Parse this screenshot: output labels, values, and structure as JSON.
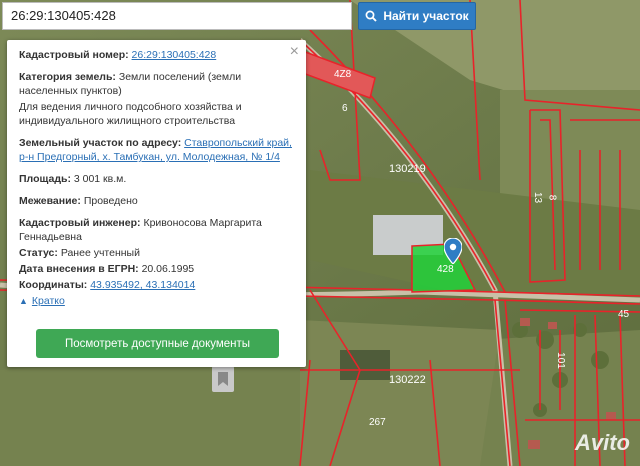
{
  "search": {
    "value": "26:29:130405:428",
    "button_label": "Найти участок"
  },
  "popup": {
    "cadastral_label": "Кадастровый номер:",
    "cadastral_value": "26:29:130405:428",
    "category_label": "Категория земель:",
    "category_value": "Земли поселений (земли населенных пунктов)",
    "usage": "Для ведения личного подсобного хозяйства и индивидуального жилищного строительства",
    "address_label": "Земельный участок по адресу:",
    "address_value": "Ставропольский край, р-н Предгорный, х. Тамбукан, ул. Молодежная, № 1/4",
    "area_label": "Площадь:",
    "area_value": "3 001 кв.м.",
    "survey_label": "Межевание:",
    "survey_value": "Проведено",
    "engineer_label": "Кадастровый инженер:",
    "engineer_value": "Кривоносова Маргарита Геннадьевна",
    "status_label": "Статус:",
    "status_value": "Ранее учтенный",
    "date_label": "Дата внесения в ЕГРН:",
    "date_value": "20.06.1995",
    "coords_label": "Координаты:",
    "coords_value": "43.935492, 43.134014",
    "collapse_label": "Кратко",
    "docs_button": "Посмотреть доступные документы"
  },
  "map_labels": {
    "parcel_top": "4Z8",
    "parcel_6": "6",
    "quarter_1": "130219",
    "parcel_13": "13",
    "parcel_8": "8",
    "parcel_selected": "428",
    "parcel_45": "45",
    "parcel_101": "101",
    "quarter_2": "130222",
    "parcel_267": "267"
  },
  "watermark": "Avito",
  "colors": {
    "accent": "#2f7dc4",
    "boundary": "#e8232a",
    "selected_parcel": "#22d13a",
    "docs_button": "#3fa855",
    "link": "#2a6fb5"
  }
}
